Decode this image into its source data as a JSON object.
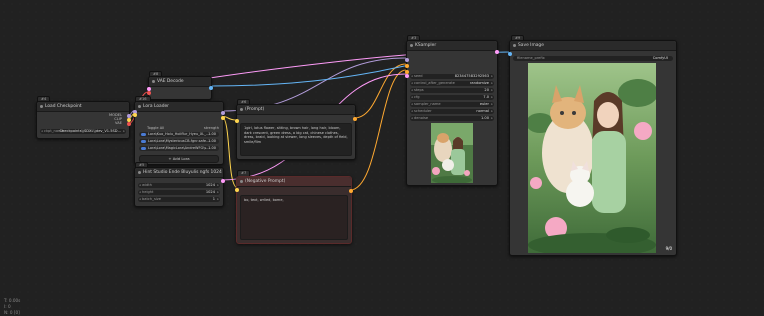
{
  "nodes": {
    "checkpoint": {
      "badge": "#4",
      "title": "Load Checkpoint",
      "outputs": [
        "MODEL",
        "CLIP",
        "VAE"
      ],
      "row_label": "ckpt_name",
      "row_value": "Checkpoints\\\\SDXL\\\\dev_V1.5SD..."
    },
    "vae_decode": {
      "badge": "#8",
      "title": "VAE Decode"
    },
    "lora": {
      "badge": "#16",
      "title": "Lora Loader",
      "toggle_label": "Toggle All",
      "strength_header": "strength",
      "items": [
        {
          "name": "Lora\\Kuo_Holu_Holiflur_Hyeu_XL_...",
          "strength": "1.00"
        },
        {
          "name": "Lora\\Lora\\MysteriousCB-fgnr.safe...",
          "strength": "1.00"
        },
        {
          "name": "Lora\\Lora\\MagicLora\\AndreWFG\\s...",
          "strength": "1.00"
        }
      ],
      "add_button": "+ Add Lora"
    },
    "positive": {
      "badge": "#6",
      "title": "(Prompt)",
      "text": "1girl, lotus flower, sitting, brown hair, long hair, bloom, dark crescent, green dress, a big cat, chinese clothes, dress, braid, looking at viewer, long sleeves, depth of field, smile/flim"
    },
    "latent": {
      "badge": "#5",
      "title": "Hint Studio Ende Bluyulis ngfs 1024",
      "rows": [
        {
          "label": "width",
          "value": "1024"
        },
        {
          "label": "height",
          "value": "1024"
        },
        {
          "label": "batch_size",
          "value": "1"
        }
      ]
    },
    "negative": {
      "badge": "#7",
      "title": "(Negative Prompt)",
      "text": "bo, text, wrlied, bome,"
    },
    "ksampler": {
      "badge": "#3",
      "title": "KSampler",
      "rows": [
        {
          "label": "seed",
          "value": "823447583292563"
        },
        {
          "label": "control_after_generate",
          "value": "randomize"
        },
        {
          "label": "steps",
          "value": "20"
        },
        {
          "label": "cfg",
          "value": "7.0"
        },
        {
          "label": "sampler_name",
          "value": "euler"
        },
        {
          "label": "scheduler",
          "value": "normal"
        },
        {
          "label": "denoise",
          "value": "1.00"
        }
      ]
    },
    "save": {
      "badge": "#9",
      "title": "Save Image",
      "row_label": "filename_prefix",
      "row_value": "ComfyUI",
      "corner": "9/0"
    }
  },
  "footer": {
    "line1": "T: 0.00s",
    "line2": "I: 0",
    "line3": "N: 0 [0]"
  },
  "colors": {
    "model": "#b39ddb",
    "clip": "#ffd54f",
    "vae": "#ef5350",
    "latent": "#ff9cf9",
    "image": "#64b5f6",
    "conditioning": "#ffa931"
  }
}
